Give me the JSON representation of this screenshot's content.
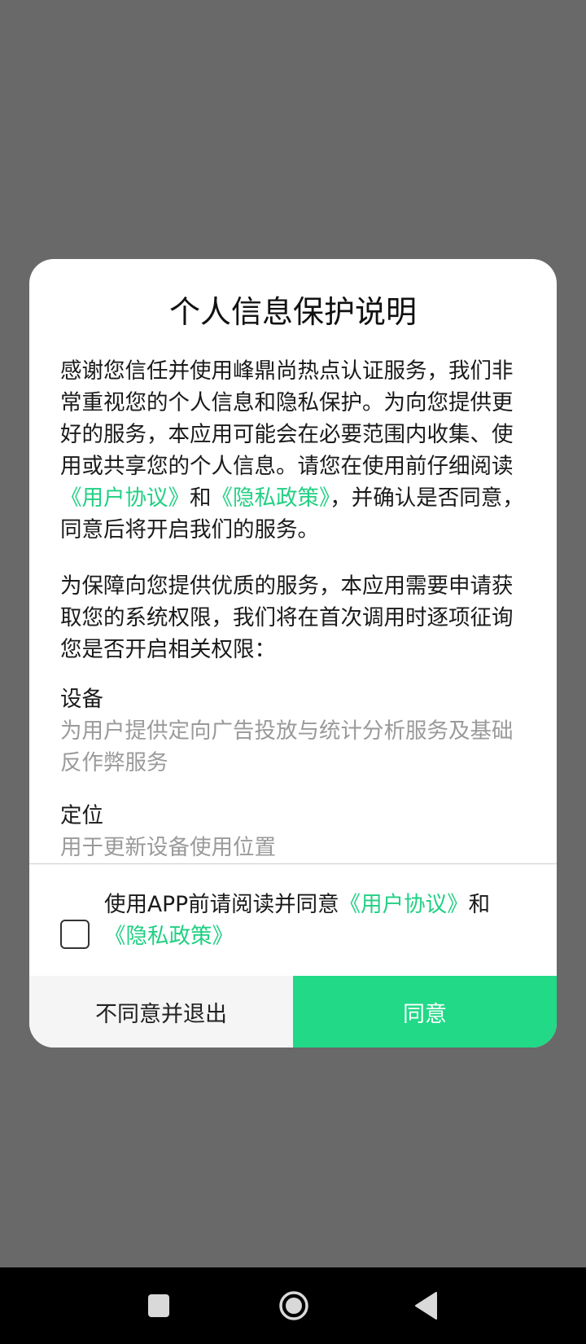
{
  "dialog": {
    "title": "个人信息保护说明",
    "intro": {
      "part1": "感谢您信任并使用峰鼎尚热点认证服务，我们非常重视您的个人信息和隐私保护。为向您提供更好的服务，本应用可能会在必要范围内收集、使用或共享您的个人信息。请您在使用前仔细阅读",
      "link_agreement": "《用户协议》",
      "and": "和",
      "link_privacy": "《隐私政策》",
      "part2": "，并确认是否同意，同意后将开启我们的服务。"
    },
    "permissions_intro": "为保障向您提供优质的服务，本应用需要申请获取您的系统权限，我们将在首次调用时逐项征询您是否开启相关权限：",
    "permissions": [
      {
        "name": "设备",
        "description": "为用户提供定向广告投放与统计分析服务及基础反作弊服务"
      },
      {
        "name": "定位",
        "description": "用于更新设备使用位置"
      }
    ],
    "consent": {
      "checked": false,
      "prefix": "使用APP前请阅读并同意",
      "link_agreement": "《用户协议》",
      "and": "和",
      "link_privacy": "《隐私政策》"
    },
    "buttons": {
      "decline_label": "不同意并退出",
      "agree_label": "同意"
    },
    "accent_color": "#21d987"
  },
  "navbar": {
    "icons": [
      "recents-square-icon",
      "home-circle-icon",
      "back-triangle-icon"
    ]
  }
}
